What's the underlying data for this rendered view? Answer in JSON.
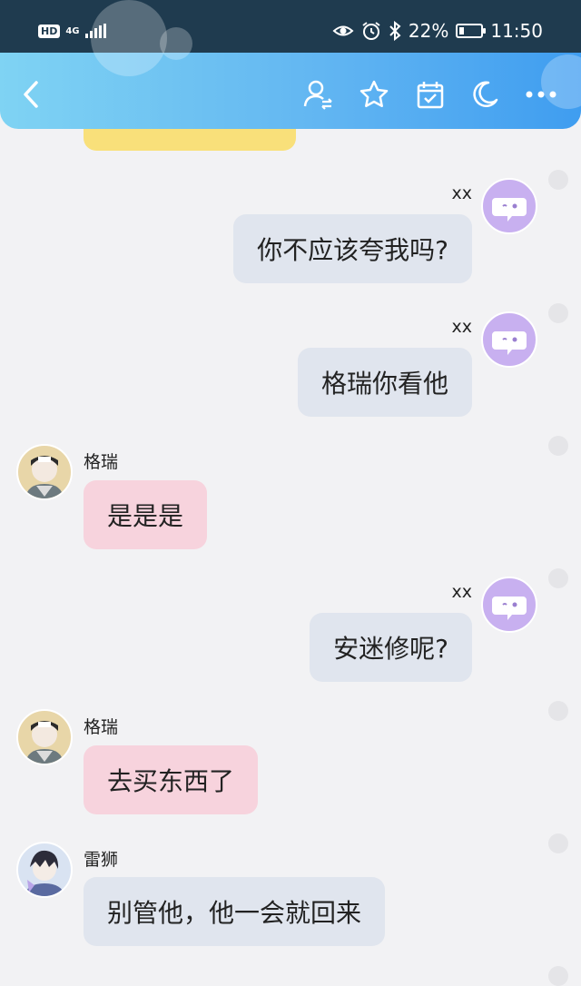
{
  "status_bar": {
    "hd": "HD",
    "network": "4G",
    "battery": "22%",
    "battery_level": 0.22,
    "time": "11:50"
  },
  "header": {
    "icons": [
      "back-arrow-icon",
      "user-switch-icon",
      "star-icon",
      "calendar-check-icon",
      "moon-icon",
      "more-dots-icon"
    ]
  },
  "messages": [
    {
      "side": "right",
      "sender": "xx",
      "text": "你不应该夸我吗?"
    },
    {
      "side": "right",
      "sender": "xx",
      "text": "格瑞你看他"
    },
    {
      "side": "left",
      "sender": "格瑞",
      "text": "是是是"
    },
    {
      "side": "right",
      "sender": "xx",
      "text": "安迷修呢?"
    },
    {
      "side": "left",
      "sender": "格瑞",
      "text": "去买东西了"
    },
    {
      "side": "left",
      "sender": "雷狮",
      "text": "别管他，他一会就回来"
    }
  ],
  "colors": {
    "self_bubble": "#e0e5ee",
    "other_bubble_pink": "#f7d3dd",
    "other_bubble_gray": "#e0e5ee",
    "top_yellow_bubble": "#f9e07a"
  }
}
